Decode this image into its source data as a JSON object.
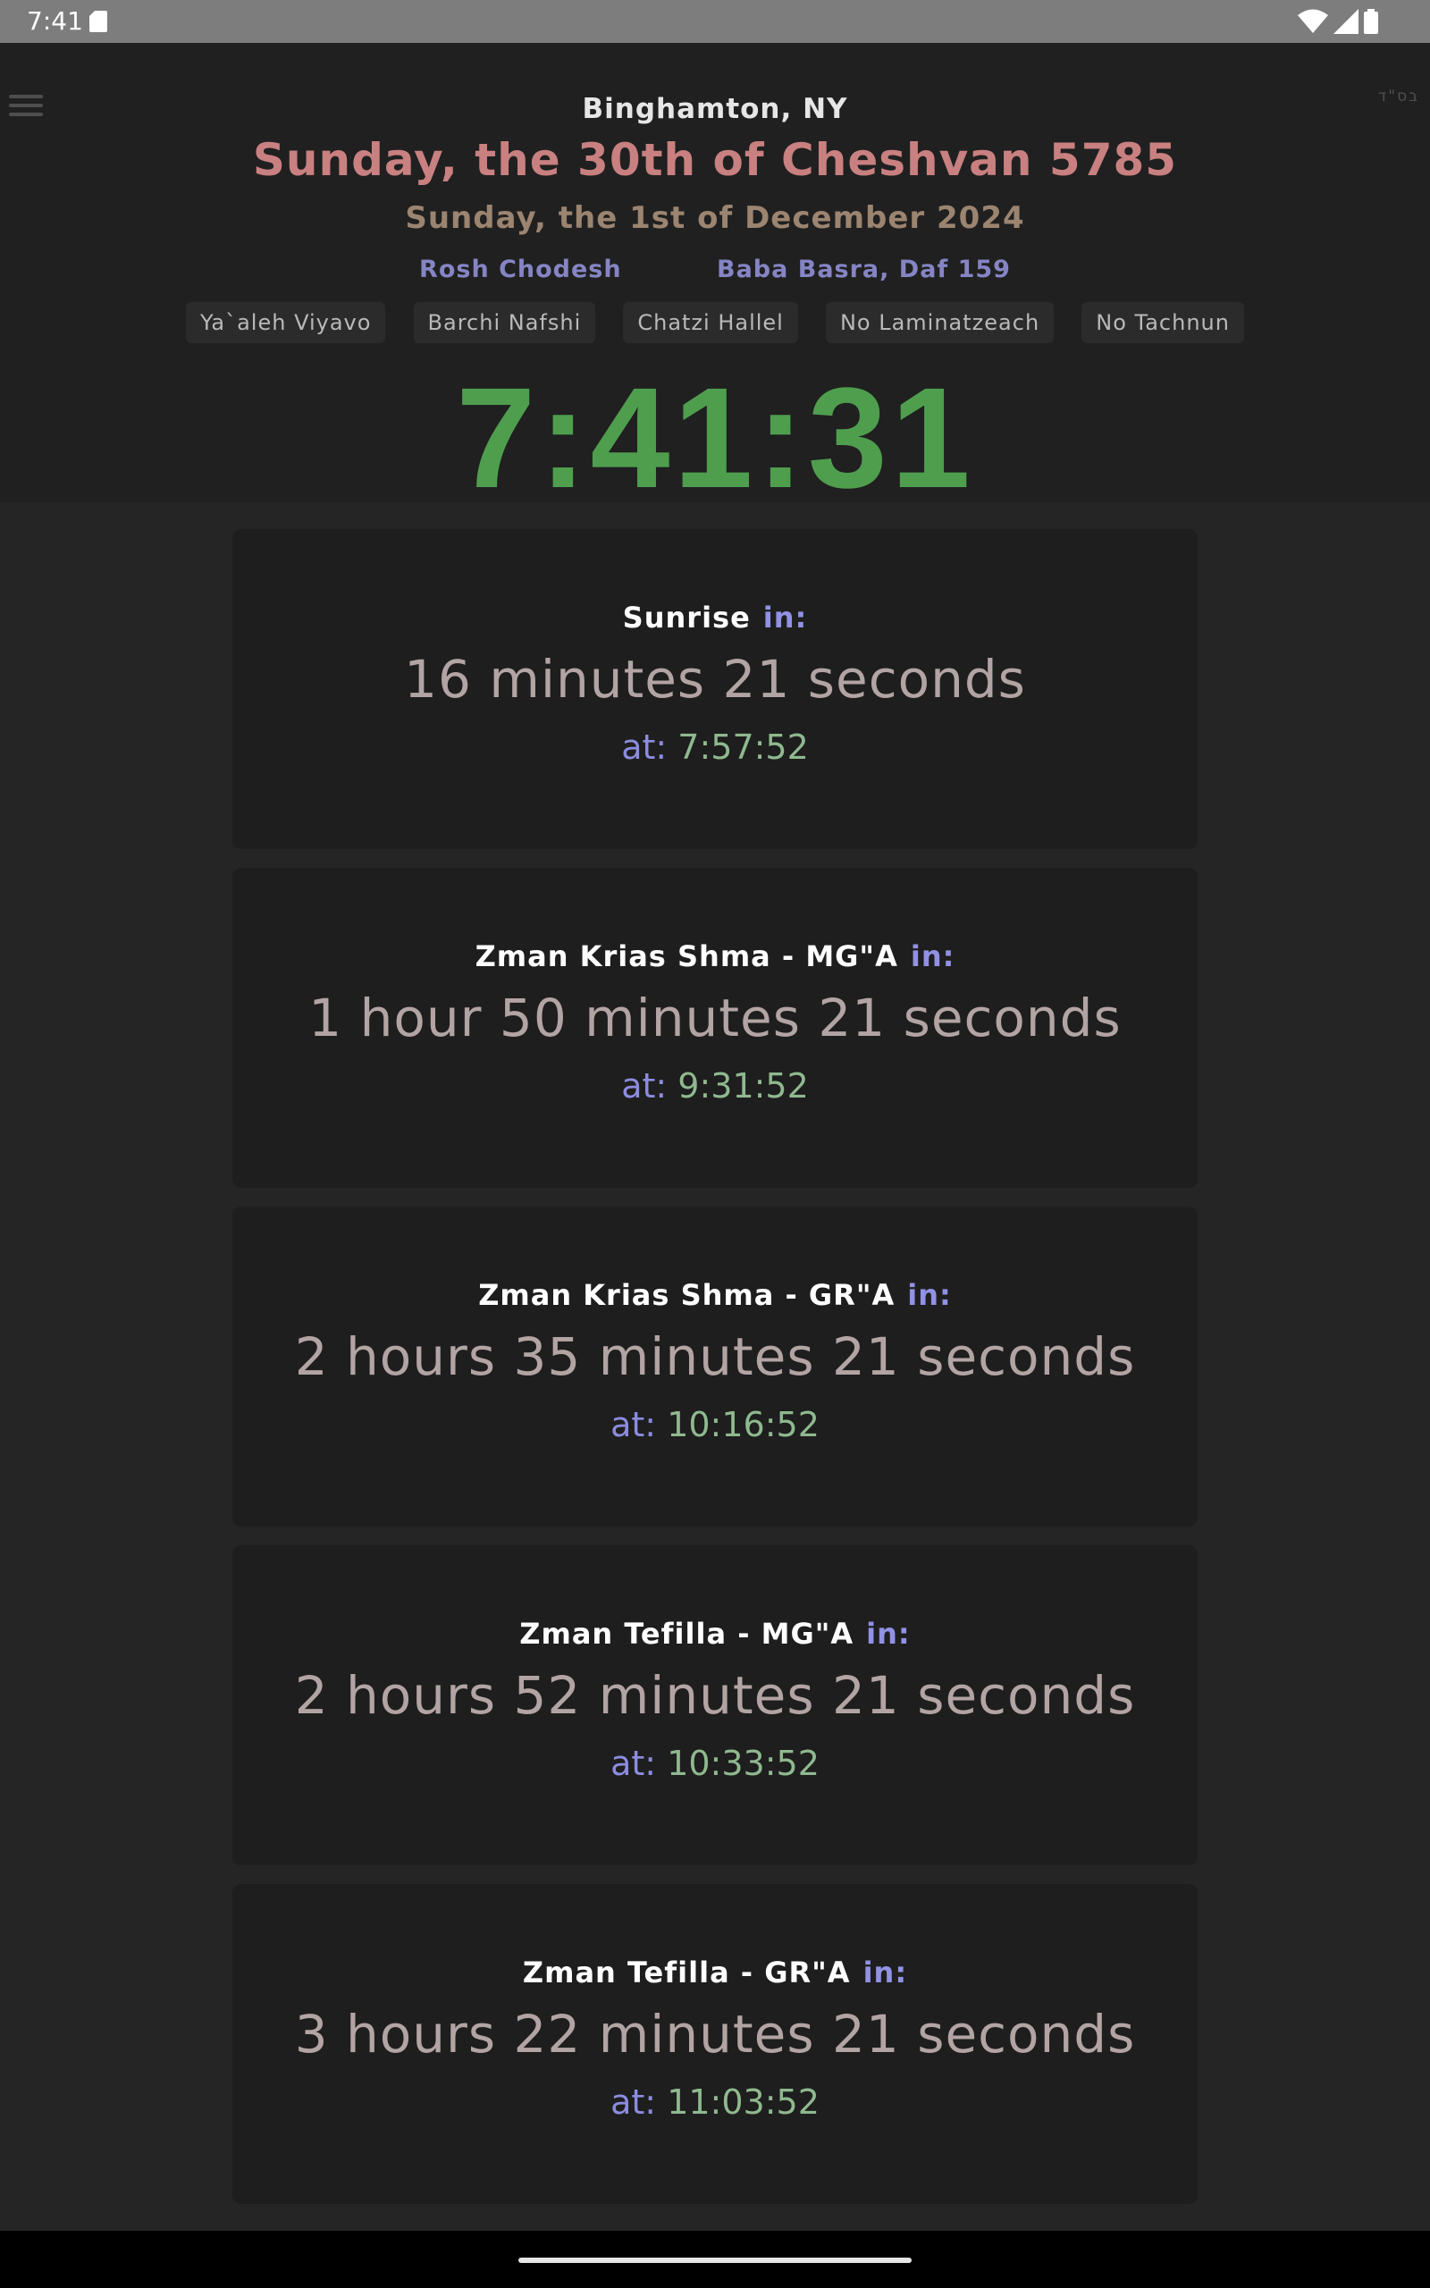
{
  "status_bar": {
    "time": "7:41",
    "icons": [
      "sd-card-icon",
      "wifi-icon",
      "signal-icon",
      "battery-icon"
    ]
  },
  "header": {
    "bsd": "בס\"ד",
    "location": "Binghamton, NY",
    "hebrew_date": "Sunday, the 30th of Cheshvan 5785",
    "gregorian_date": "Sunday, the 1st of December 2024",
    "info": [
      "Rosh Chodesh",
      "Baba Basra, Daf 159"
    ],
    "tags": [
      "Ya`aleh Viyavo",
      "Barchi Nafshi",
      "Chatzi Hallel",
      "No Laminatzeach",
      "No Tachnun"
    ],
    "clock": "7:41:31"
  },
  "zmanim": [
    {
      "title": "Sunrise",
      "in_label": "in:",
      "countdown": "16 minutes 21 seconds",
      "at_label": "at:",
      "at_time": "7:57:52"
    },
    {
      "title": "Zman Krias Shma - MG\"A",
      "in_label": "in:",
      "countdown": "1 hour 50 minutes 21 seconds",
      "at_label": "at:",
      "at_time": "9:31:52"
    },
    {
      "title": "Zman Krias Shma - GR\"A",
      "in_label": "in:",
      "countdown": "2 hours 35 minutes 21 seconds",
      "at_label": "at:",
      "at_time": "10:16:52"
    },
    {
      "title": "Zman Tefilla - MG\"A",
      "in_label": "in:",
      "countdown": "2 hours 52 minutes 21 seconds",
      "at_label": "at:",
      "at_time": "10:33:52"
    },
    {
      "title": "Zman Tefilla - GR\"A",
      "in_label": "in:",
      "countdown": "3 hours 22 minutes 21 seconds",
      "at_label": "at:",
      "at_time": "11:03:52"
    }
  ],
  "colors": {
    "background": "#252525",
    "header_bg": "#202020",
    "card_bg": "#1e1e1e",
    "hebrew_date": "#c98080",
    "gregorian_date": "#9b8470",
    "info": "#8585c5",
    "clock": "#4e9e4e",
    "in_label": "#9191e6",
    "at_time": "#8fb98f"
  }
}
